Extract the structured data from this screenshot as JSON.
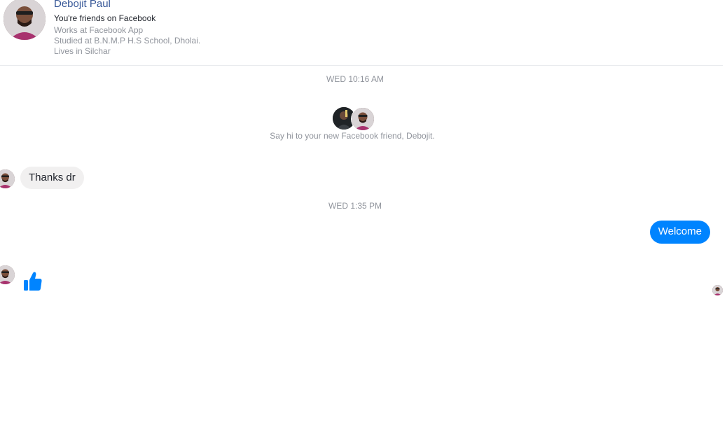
{
  "profile": {
    "name": "Debojit Paul",
    "friends_status": "You're friends on Facebook",
    "work": "Works at Facebook App",
    "education": "Studied at B.N.M.P H.S School, Dholai.",
    "location": "Lives in Silchar"
  },
  "conversation": {
    "timestamp_1": "WED 10:16 AM",
    "intro_text": "Say hi to your new Facebook friend, Debojit.",
    "timestamp_2": "WED 1:35 PM",
    "messages": [
      {
        "sender": "them",
        "text": "Thanks dr"
      },
      {
        "sender": "me",
        "text": "Welcome"
      },
      {
        "sender": "them",
        "icon": "thumbs-up-icon"
      }
    ]
  },
  "colors": {
    "accent": "#0084ff",
    "name_link": "#385898",
    "muted": "#90949c",
    "incoming_bubble": "#f1f0f0"
  }
}
